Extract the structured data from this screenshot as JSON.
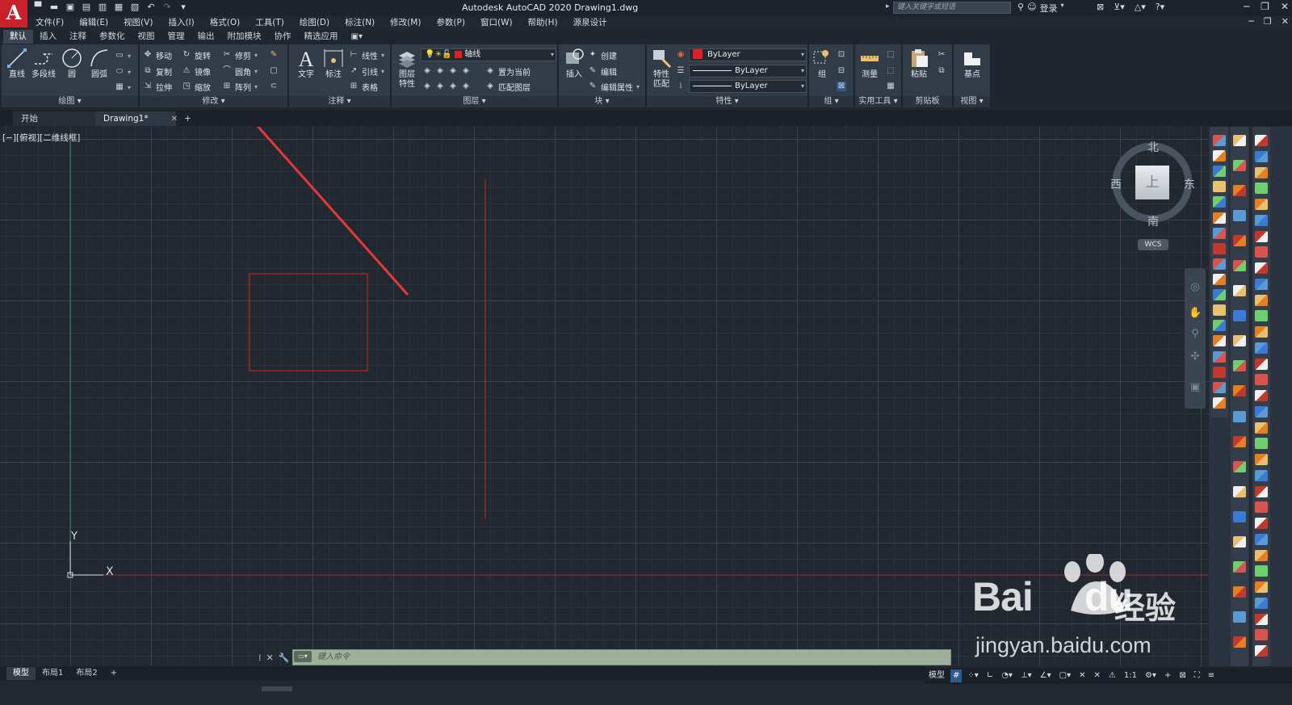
{
  "titlebar": {
    "app_logo": "A",
    "title": "Autodesk AutoCAD 2020    Drawing1.dwg",
    "search_placeholder": "键入关键字或短语",
    "login": "登录",
    "qat_icons": [
      "new-file-icon",
      "open-icon",
      "save-icon",
      "save-as-icon",
      "open-web-icon",
      "save-web-icon",
      "plot-icon",
      "undo-icon",
      "redo-icon",
      "customize-icon"
    ]
  },
  "menubar": [
    "文件(F)",
    "编辑(E)",
    "视图(V)",
    "插入(I)",
    "格式(O)",
    "工具(T)",
    "绘图(D)",
    "标注(N)",
    "修改(M)",
    "参数(P)",
    "窗口(W)",
    "帮助(H)",
    "源泉设计"
  ],
  "ribbon_tabs": [
    "默认",
    "插入",
    "注释",
    "参数化",
    "视图",
    "管理",
    "输出",
    "附加模块",
    "协作",
    "精选应用"
  ],
  "ribbon": {
    "draw": {
      "title": "绘图",
      "line": "直线",
      "polyline": "多段线",
      "circle": "圆",
      "arc": "圆弧"
    },
    "modify": {
      "title": "修改",
      "move": "移动",
      "rotate": "旋转",
      "trim": "修剪",
      "copy": "复制",
      "mirror": "镜像",
      "fillet": "圆角",
      "stretch": "拉伸",
      "scale": "缩放",
      "array": "阵列"
    },
    "annotation": {
      "title": "注释",
      "text": "文字",
      "dimension": "标注",
      "linear": "线性",
      "leader": "引线",
      "table": "表格"
    },
    "layers": {
      "title": "图层",
      "layer_props": "图层\n特性",
      "layer_props_l1": "图层",
      "layer_props_l2": "特性",
      "current_layer": "轴线",
      "set_current": "置为当前",
      "match_layer": "匹配图层"
    },
    "block": {
      "title": "块",
      "insert": "插入",
      "create": "创建",
      "edit": "编辑",
      "edit_attr": "编辑属性"
    },
    "properties": {
      "title": "特性",
      "match_l1": "特性",
      "match_l2": "匹配",
      "color": "ByLayer",
      "linetype": "ByLayer",
      "lineweight": "ByLayer"
    },
    "groups": {
      "title": "组",
      "group": "组"
    },
    "utilities": {
      "title": "实用工具",
      "measure": "测量"
    },
    "clipboard": {
      "title": "剪贴板",
      "paste": "粘贴"
    },
    "view": {
      "title": "视图",
      "base": "基点"
    }
  },
  "file_tabs": {
    "start": "开始",
    "drawing": "Drawing1*",
    "add": "+"
  },
  "viewport": {
    "label": "[−][俯视][二维线框]",
    "ucs_y": "Y",
    "ucs_x": "X"
  },
  "viewcube": {
    "north": "北",
    "south": "南",
    "east": "东",
    "west": "西",
    "face": "上",
    "wcs": "WCS"
  },
  "command": {
    "placeholder": "键入命令"
  },
  "layout_tabs": [
    "模型",
    "布局1",
    "布局2",
    "+"
  ],
  "statusbar": {
    "model": "模型",
    "scale": "1:1"
  },
  "watermark": {
    "brand_latin": "Bai",
    "brand_du": "du",
    "brand_cn": "经验",
    "url": "jingyan.baidu.com"
  },
  "colors": {
    "accent_red": "#e02020",
    "canvas": "#212830",
    "ribbon": "#323b48",
    "cmd_bg": "#9fb09a"
  }
}
